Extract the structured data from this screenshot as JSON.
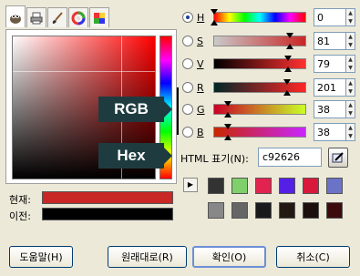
{
  "tabs": [
    {
      "icon": "gimp-wilber-icon"
    },
    {
      "icon": "printer-icon"
    },
    {
      "icon": "paintbrush-icon"
    },
    {
      "icon": "color-wheel-icon"
    },
    {
      "icon": "color-palette-icon"
    }
  ],
  "colors": {
    "current": "#c92626",
    "previous": "#000000",
    "callout_bg": "#1e3c40"
  },
  "swatches": {
    "current_label": "현재:",
    "previous_label": "이전:"
  },
  "channels": [
    {
      "letter": "H",
      "value": "0",
      "selected": true
    },
    {
      "letter": "S",
      "value": "81",
      "selected": false
    },
    {
      "letter": "V",
      "value": "79",
      "selected": false
    },
    {
      "letter": "R",
      "value": "201",
      "selected": false
    },
    {
      "letter": "G",
      "value": "38",
      "selected": false
    },
    {
      "letter": "B",
      "value": "38",
      "selected": false
    }
  ],
  "callouts": {
    "rgb": "RGB",
    "hex": "Hex"
  },
  "hex": {
    "label": "HTML 표기(N):",
    "value": "c92626"
  },
  "history_colors": [
    "#333333",
    "#7fd06a",
    "#e2234f",
    "#5520e6",
    "#d9193b",
    "#6b73c8",
    "#888888",
    "#666666",
    "#1a1a1a",
    "#221a12",
    "#1c0f0d",
    "#3c0c0c"
  ],
  "buttons": {
    "help": "도움말(H)",
    "reset": "원래대로(R)",
    "ok": "확인(O)",
    "cancel": "취소(C)"
  }
}
